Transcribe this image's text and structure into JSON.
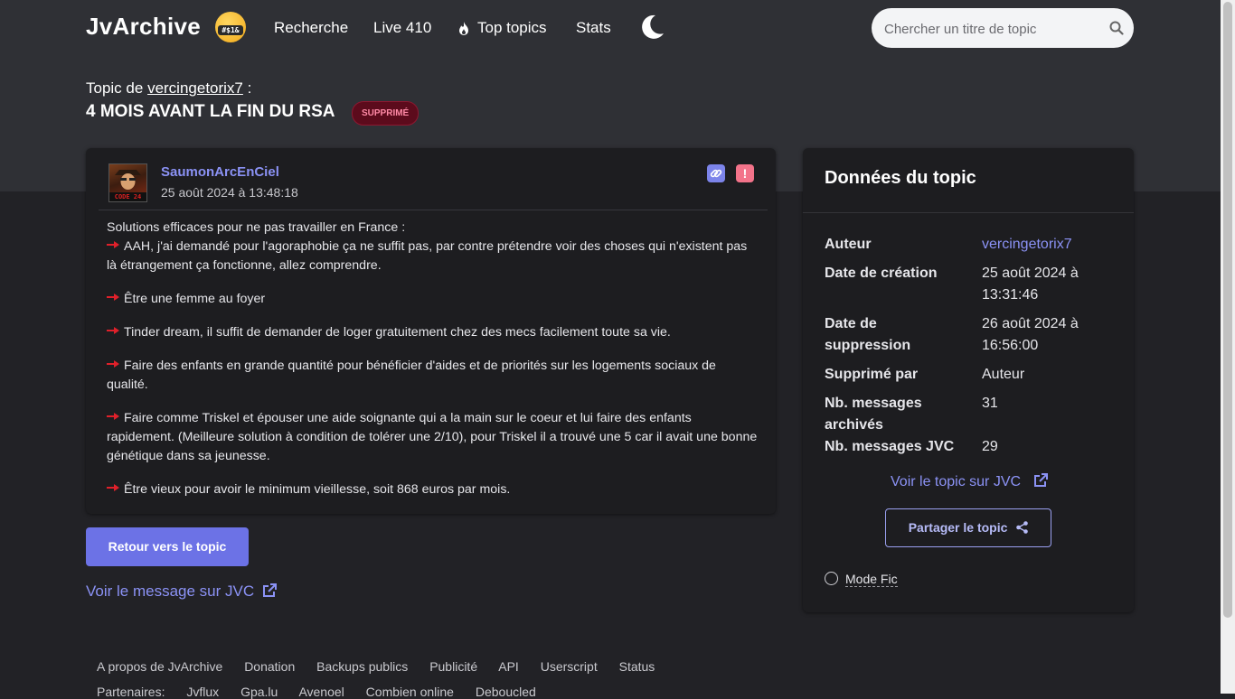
{
  "header": {
    "brand": "JvArchive",
    "badge_text": "#$1&",
    "nav": [
      "Recherche",
      "Live 410",
      "Top topics",
      "Stats"
    ],
    "search_placeholder": "Chercher un titre de topic"
  },
  "topic": {
    "prefix": "Topic de",
    "author": "vercingetorix7",
    "suffix": ":",
    "title": "4 MOIS AVANT LA FIN DU RSA",
    "badge": "SUPPRIMÉ"
  },
  "message": {
    "avatar_tag": "CODE 24",
    "author": "SaumonArcEnCiel",
    "date": "25 août 2024 à 13:48:18",
    "report_label": "!",
    "intro": "Solutions efficaces pour ne pas travailler en France :",
    "items": [
      "AAH, j'ai demandé pour l'agoraphobie ça ne suffit pas, par contre prétendre voir des choses qui n'existent pas là étrangement ça fonctionne, allez comprendre.",
      "Être une femme au foyer",
      "Tinder dream, il suffit de demander de loger gratuitement chez des mecs facilement toute sa vie.",
      "Faire des enfants en grande quantité pour bénéficier d'aides et de priorités sur les logements sociaux de qualité.",
      "Faire comme Triskel et épouser une aide soignante qui a la main sur le coeur et lui faire des enfants rapidement. (Meilleure solution à condition de tolérer une 2/10), pour Triskel il a trouvé une 5 car il avait une bonne génétique dans sa jeunesse.",
      "Être vieux pour avoir le minimum vieillesse, soit 868 euros par mois."
    ],
    "back_button": "Retour vers le topic",
    "jvc_link": "Voir le message sur JVC"
  },
  "panel": {
    "title": "Données du topic",
    "rows": [
      {
        "label": "Auteur",
        "value": "vercingetorix7"
      },
      {
        "label": "Date de création",
        "value": "25 août 2024 à 13:31:46"
      },
      {
        "label": "Date de suppression",
        "value": "26 août 2024 à 16:56:00"
      },
      {
        "label": "Supprimé par",
        "value": "Auteur"
      },
      {
        "label": "Nb. messages archivés",
        "value": "31"
      },
      {
        "label": "Nb. messages JVC",
        "value": "29"
      }
    ],
    "topic_jvc_link": "Voir le topic sur JVC",
    "share_button": "Partager le topic",
    "mode_fic": "Mode Fic"
  },
  "footer": {
    "links": [
      "A propos de JvArchive",
      "Donation",
      "Backups publics",
      "Publicité",
      "API",
      "Userscript",
      "Status"
    ],
    "partners_label": "Partenaires:",
    "partners": [
      "Jvflux",
      "Gpa.lu",
      "Avenoel",
      "Combien online",
      "Deboucled"
    ]
  },
  "colors": {
    "accent": "#8b92f5",
    "button": "#6c72e6",
    "deleted_badge": "#5c0b1c"
  }
}
